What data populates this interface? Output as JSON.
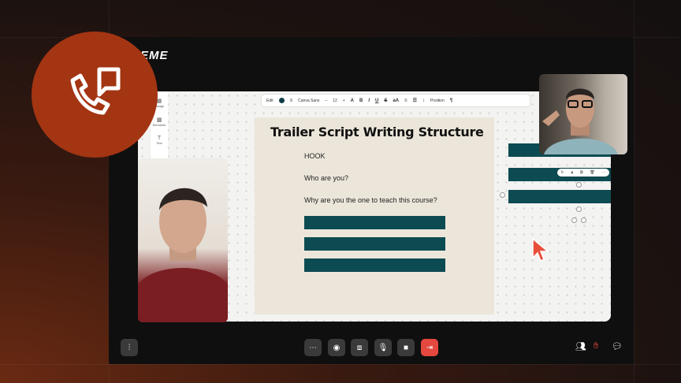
{
  "logo": {
    "text": "EME"
  },
  "slide": {
    "title": "Trailer Script Writing Structure",
    "lines": [
      "HOOK",
      "Who are you?",
      "Why are you the one to teach this course?"
    ]
  },
  "canva_toolbar": {
    "edit_label": "Edit",
    "font_name": "Canva Sans",
    "font_size": "12",
    "position_label": "Position"
  },
  "left_rail": {
    "items": [
      "Design",
      "Elements",
      "Text"
    ]
  },
  "icons": {
    "call_badge": "phone-chat-icon",
    "more": "more-dots-icon",
    "record": "record-icon",
    "share_screen": "share-screen-icon",
    "mic": "microphone-icon",
    "camera": "camera-icon",
    "leave": "leave-call-icon",
    "audio": "audio-waveform-icon",
    "participants": "participants-icon",
    "reactions": "raise-hand-icon",
    "chat": "chat-icon"
  },
  "colors": {
    "badge": "#a33513",
    "slide_bar": "#0d4b52",
    "leave_button": "#e5483e",
    "cursor": "#e84e3a"
  }
}
